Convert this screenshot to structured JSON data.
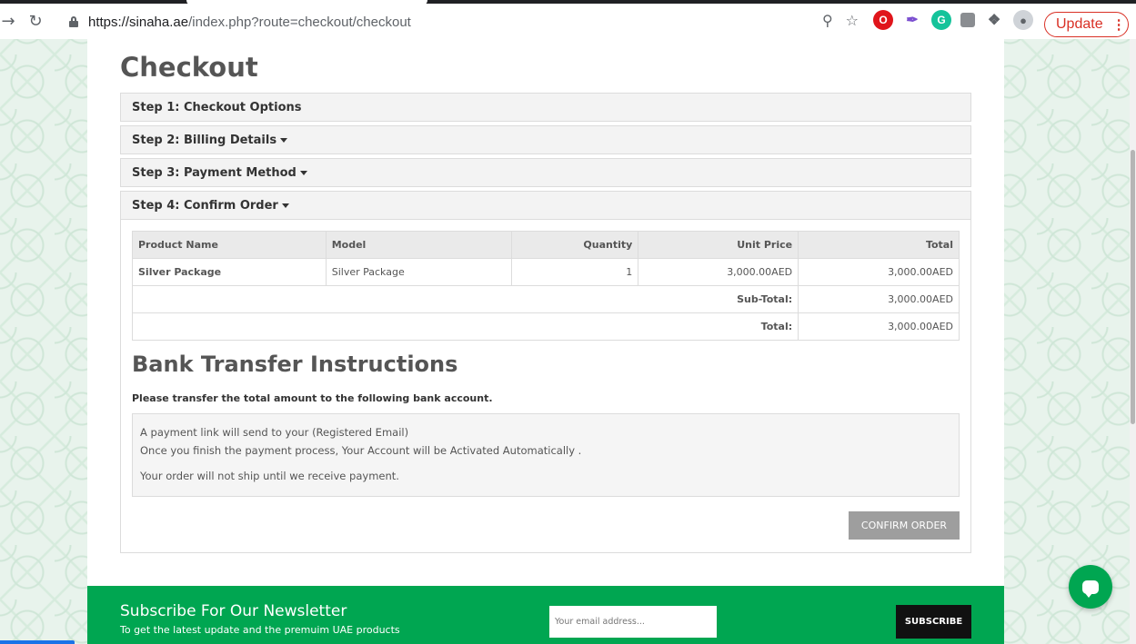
{
  "browser": {
    "url_host": "https://sinaha.ae",
    "url_path": "/index.php?route=checkout/checkout",
    "update_label": "Update"
  },
  "page": {
    "title": "Checkout"
  },
  "steps": [
    {
      "label": "Step 1: Checkout Options"
    },
    {
      "label": "Step 2: Billing Details"
    },
    {
      "label": "Step 3: Payment Method"
    },
    {
      "label": "Step 4: Confirm Order"
    }
  ],
  "order_table": {
    "headers": [
      "Product Name",
      "Model",
      "Quantity",
      "Unit Price",
      "Total"
    ],
    "rows": [
      {
        "product": "Silver Package",
        "model": "Silver Package",
        "quantity": "1",
        "unit_price": "3,000.00AED",
        "total": "3,000.00AED"
      }
    ],
    "subtotal_label": "Sub-Total:",
    "subtotal_value": "3,000.00AED",
    "total_label": "Total:",
    "total_value": "3,000.00AED"
  },
  "bank": {
    "title": "Bank Transfer Instructions",
    "subtitle": "Please transfer the total amount to the following bank account.",
    "line1": "A payment link will send to your (Registered Email)",
    "line2": "Once you finish the payment process, Your Account will be Activated Automatically .",
    "line3": "Your order will not ship until we receive payment."
  },
  "confirm_label": "CONFIRM ORDER",
  "newsletter": {
    "title": "Subscribe For Our Newsletter",
    "subtitle": "To get the latest update and the premuim UAE products",
    "placeholder": "Your email address...",
    "button": "SUBSCRIBE"
  },
  "colors": {
    "brand_green": "#00a651",
    "update_red": "#d93025"
  }
}
